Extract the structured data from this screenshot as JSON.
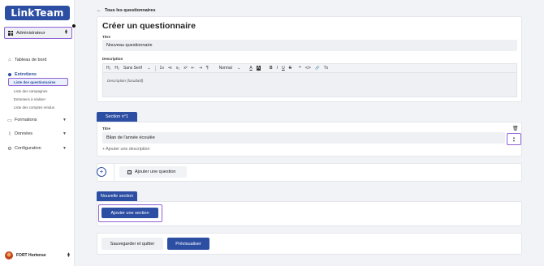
{
  "sidebar": {
    "logo": "LinkTeam",
    "role": "Administrateur",
    "nav": [
      {
        "label": "Tableau de bord"
      },
      {
        "label": "Entretiens"
      },
      {
        "label": "Formations"
      },
      {
        "label": "Données"
      },
      {
        "label": "Configuration"
      }
    ],
    "entretiens_sub": [
      "Liste des questionnaires",
      "Liste des campagnes",
      "Entretiens à réaliser",
      "Liste des comptes rendus"
    ],
    "user": "FORT Hortense"
  },
  "main": {
    "back_link": "Tous les questionnaires",
    "page_title": "Créer un questionnaire",
    "title_label": "Titre",
    "title_value": "Nouveau questionnaire",
    "description_label": "Description",
    "toolbar": {
      "h1": "H₁",
      "h2": "H₂",
      "font": "Sans Serif",
      "ordered_list": "1≡",
      "bullet_list": "•≡",
      "subscript": "x₂",
      "superscript": "x²",
      "outdent": "⇤",
      "indent": "⇥",
      "direction": "¶",
      "size": "Normal",
      "color": "A",
      "background": "A",
      "bold": "B",
      "italic": "I",
      "underline": "U",
      "strike": "S",
      "quote": "❝",
      "code": "</>",
      "link": "🔗",
      "clear": "Tx"
    },
    "description_placeholder": "Description (facultatif)",
    "section": {
      "tab_label": "Section n°1",
      "title_label": "Titre",
      "title_value": "Bilan de l'année écoulée",
      "add_description": "+ Ajouter une description",
      "add_question": "Ajouter une question"
    },
    "new_section": {
      "tab_label": "Nouvelle section",
      "add_button": "Ajouter une section"
    },
    "actions": {
      "save_quit": "Sauvegarder et quitter",
      "preview": "Prévisualiser"
    }
  },
  "colors": {
    "brand": "#2c4ea3",
    "highlight": "#8f62d6",
    "background": "#f2f3f6"
  }
}
